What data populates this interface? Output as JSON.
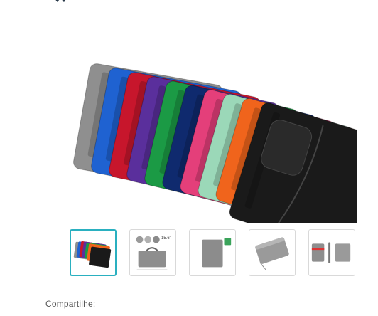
{
  "gallery": {
    "main_image_alt": "",
    "thumbnails": [
      {
        "name": "thumb-colors",
        "active": true
      },
      {
        "name": "thumb-dimensions",
        "active": false,
        "size_label": "15.6\""
      },
      {
        "name": "thumb-gray-flat",
        "active": false
      },
      {
        "name": "thumb-gray-angle",
        "active": false
      },
      {
        "name": "thumb-set",
        "active": false
      }
    ]
  },
  "colors": {
    "accent": "#2ab0c0",
    "sleeve_colors": [
      "#8f8f8f",
      "#1f62d1",
      "#c7162c",
      "#5a2f9c",
      "#1b9a45",
      "#0f2a6e",
      "#e43f7a",
      "#9bd8b8",
      "#f0641c",
      "#1a1a1a"
    ]
  },
  "share": {
    "label": "Compartilhe:"
  }
}
